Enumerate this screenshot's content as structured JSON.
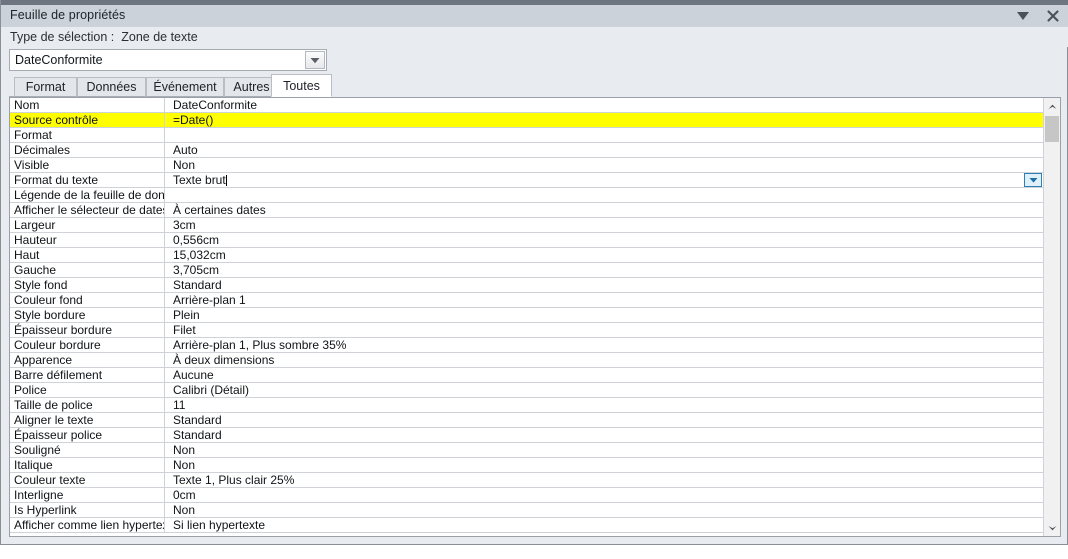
{
  "window": {
    "title": "Feuille de propriétés",
    "collapse_icon": "chevron-down-icon",
    "close_icon": "close-icon"
  },
  "selection": {
    "label": "Type de sélection :",
    "value": "Zone de texte"
  },
  "object_combo": {
    "value": "DateConformite",
    "arrow_icon": "chevron-down-icon"
  },
  "tabs": [
    {
      "label": "Format",
      "active": false
    },
    {
      "label": "Données",
      "active": false
    },
    {
      "label": "Événement",
      "active": false
    },
    {
      "label": "Autres",
      "active": false
    },
    {
      "label": "Toutes",
      "active": true
    }
  ],
  "properties": [
    {
      "label": "Nom",
      "value": "DateConformite",
      "highlight": false,
      "active": false
    },
    {
      "label": "Source contrôle",
      "value": "=Date()",
      "highlight": true,
      "active": false
    },
    {
      "label": "Format",
      "value": "",
      "highlight": false,
      "active": false
    },
    {
      "label": "Décimales",
      "value": "Auto",
      "highlight": false,
      "active": false
    },
    {
      "label": "Visible",
      "value": "Non",
      "highlight": false,
      "active": false
    },
    {
      "label": "Format du texte",
      "value": "Texte brut",
      "highlight": false,
      "active": true
    },
    {
      "label": "Légende de la feuille de données",
      "value": "",
      "highlight": false,
      "active": false
    },
    {
      "label": "Afficher le sélecteur de dates",
      "value": "À certaines dates",
      "highlight": false,
      "active": false
    },
    {
      "label": "Largeur",
      "value": "3cm",
      "highlight": false,
      "active": false
    },
    {
      "label": "Hauteur",
      "value": "0,556cm",
      "highlight": false,
      "active": false
    },
    {
      "label": "Haut",
      "value": "15,032cm",
      "highlight": false,
      "active": false
    },
    {
      "label": "Gauche",
      "value": "3,705cm",
      "highlight": false,
      "active": false
    },
    {
      "label": "Style fond",
      "value": "Standard",
      "highlight": false,
      "active": false
    },
    {
      "label": "Couleur fond",
      "value": "Arrière-plan 1",
      "highlight": false,
      "active": false
    },
    {
      "label": "Style bordure",
      "value": "Plein",
      "highlight": false,
      "active": false
    },
    {
      "label": "Épaisseur bordure",
      "value": "Filet",
      "highlight": false,
      "active": false
    },
    {
      "label": "Couleur bordure",
      "value": "Arrière-plan 1, Plus sombre 35%",
      "highlight": false,
      "active": false
    },
    {
      "label": "Apparence",
      "value": "À deux dimensions",
      "highlight": false,
      "active": false
    },
    {
      "label": "Barre défilement",
      "value": "Aucune",
      "highlight": false,
      "active": false
    },
    {
      "label": "Police",
      "value": "Calibri (Détail)",
      "highlight": false,
      "active": false
    },
    {
      "label": "Taille de police",
      "value": "11",
      "highlight": false,
      "active": false
    },
    {
      "label": "Aligner le texte",
      "value": "Standard",
      "highlight": false,
      "active": false
    },
    {
      "label": "Épaisseur police",
      "value": "Standard",
      "highlight": false,
      "active": false
    },
    {
      "label": "Souligné",
      "value": "Non",
      "highlight": false,
      "active": false
    },
    {
      "label": "Italique",
      "value": "Non",
      "highlight": false,
      "active": false
    },
    {
      "label": "Couleur texte",
      "value": "Texte 1, Plus clair 25%",
      "highlight": false,
      "active": false
    },
    {
      "label": "Interligne",
      "value": "0cm",
      "highlight": false,
      "active": false
    },
    {
      "label": "Is Hyperlink",
      "value": "Non",
      "highlight": false,
      "active": false
    },
    {
      "label": "Afficher comme lien hypertexte",
      "value": "Si lien hypertexte",
      "highlight": false,
      "active": false
    }
  ],
  "scrollbar": {
    "up_icon": "chevron-up-icon",
    "down_icon": "chevron-down-icon"
  },
  "colors": {
    "title_bar": "#ccd2da",
    "title_strip": "#6d7580",
    "panel_bg": "#e8ebf0",
    "highlight": "#ffff00",
    "active_border": "#2a7fb8"
  }
}
